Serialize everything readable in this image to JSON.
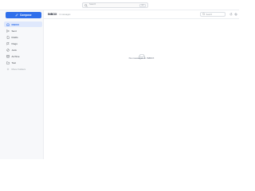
{
  "topbar": {
    "search_placeholder": "Search",
    "search_shortcut": "⌘K"
  },
  "sidebar": {
    "compose_label": "Compose",
    "items": [
      {
        "label": "INBOX",
        "icon": "inbox-icon",
        "active": true
      },
      {
        "label": "Sent",
        "icon": "send-icon",
        "active": false
      },
      {
        "label": "Drafts",
        "icon": "draft-icon",
        "active": false
      },
      {
        "label": "Flags",
        "icon": "flag-icon",
        "active": false
      },
      {
        "label": "Junk",
        "icon": "junk-icon",
        "active": false
      },
      {
        "label": "Archive",
        "icon": "archive-icon",
        "active": false
      },
      {
        "label": "Test",
        "icon": "folder-icon",
        "active": false
      }
    ],
    "more_label": "More Folders"
  },
  "main": {
    "folder_title": "INBOX",
    "message_count": "0 messages",
    "search_placeholder": "Search",
    "empty_text": "No messages in INBOX"
  },
  "colors": {
    "accent": "#2f6feb",
    "active_bg": "#dfe8fc",
    "sidebar_bg": "#f7f8fa"
  }
}
